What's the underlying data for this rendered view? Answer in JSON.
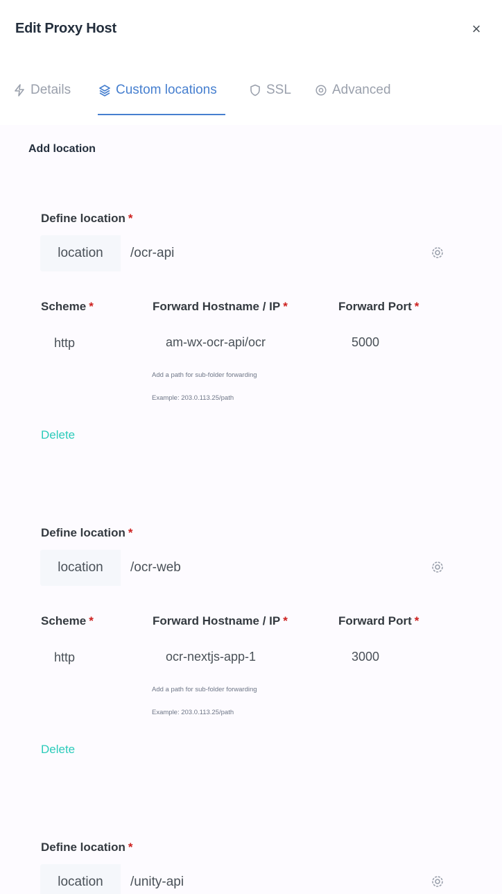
{
  "modal": {
    "title": "Edit Proxy Host",
    "close_label": "×"
  },
  "tabs": [
    {
      "label": "Details",
      "icon": "zap-icon",
      "active": false
    },
    {
      "label": "Custom locations",
      "icon": "layers-icon",
      "active": true
    },
    {
      "label": "SSL",
      "icon": "shield-icon",
      "active": false
    },
    {
      "label": "Advanced",
      "icon": "settings-icon",
      "active": false
    }
  ],
  "content": {
    "add_location_label": "Add location",
    "define_location_label": "Define location",
    "required_mark": "*",
    "location_prefix": "location",
    "scheme_label": "Scheme",
    "hostname_label": "Forward Hostname / IP",
    "port_label": "Forward Port",
    "hint_line1": "Add a path for sub-folder forwarding",
    "hint_line2": "Example: 203.0.113.25/path",
    "delete_label": "Delete",
    "locations": [
      {
        "path": "/ocr-api",
        "scheme": "http",
        "hostname": "am-wx-ocr-api/ocr",
        "port": "5000"
      },
      {
        "path": "/ocr-web",
        "scheme": "http",
        "hostname": "ocr-nextjs-app-1",
        "port": "3000"
      },
      {
        "path": "/unity-api"
      }
    ]
  },
  "colors": {
    "accent": "#467fcf",
    "delete": "#2bcbba",
    "required": "#cd201f"
  }
}
